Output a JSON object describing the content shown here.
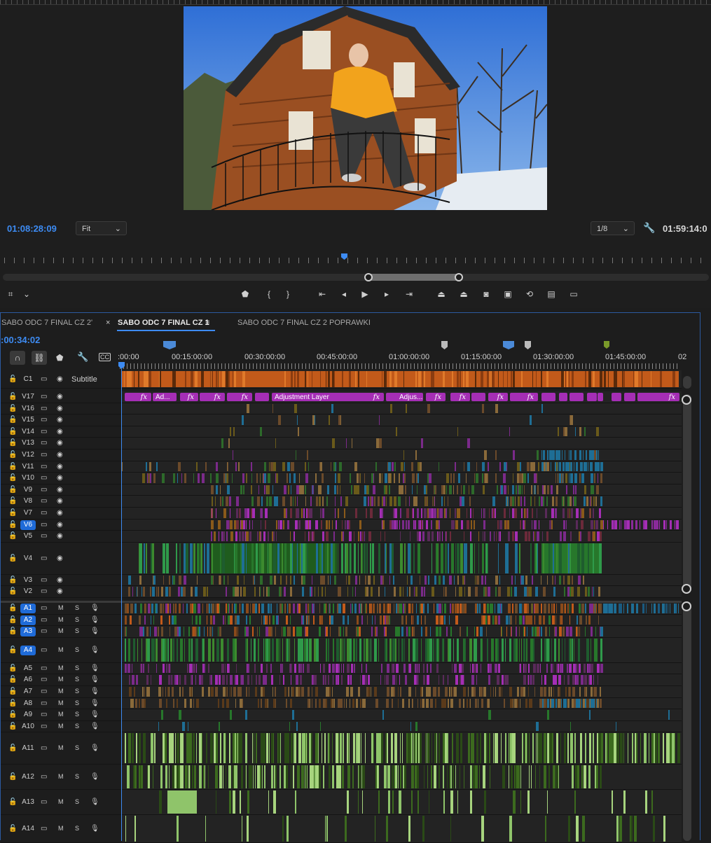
{
  "monitor": {
    "current_timecode": "01:08:28:09",
    "zoom_value": "Fit",
    "resolution_value": "1/8",
    "duration_timecode": "01:59:14:0",
    "playhead_fraction": 0.484
  },
  "timeline": {
    "tabs": [
      {
        "label": "SABO ODC 7 FINAL CZ 2'",
        "active": false
      },
      {
        "label": "SABO ODC 7 FINAL CZ 1",
        "active": true
      },
      {
        "label": "SABO ODC 7 FINAL CZ 2 POPRAWKI",
        "active": false
      }
    ],
    "close_glyph": "×",
    "menu_glyph": "≡",
    "current_timecode": ":00:34:02",
    "ruler_labels": [
      ":00:00",
      "00:15:00:00",
      "00:30:00:00",
      "00:45:00:00",
      "01:00:00:00",
      "01:15:00:00",
      "01:30:00:00",
      "01:45:00:00",
      "02"
    ],
    "subtitle_track": {
      "name": "C1",
      "label": "Subtitle"
    },
    "adjustment_layer_label": "Adjustment Layer",
    "adj_short_1": "Ad...",
    "adj_short_2": "Adjus...",
    "fx_label": "fx",
    "mute_label": "M",
    "solo_label": "S",
    "video_tracks": [
      "V17",
      "V16",
      "V15",
      "V14",
      "V13",
      "V12",
      "V11",
      "V10",
      "V9",
      "V8",
      "V7",
      "V6",
      "V5",
      "V4",
      "V3",
      "V2"
    ],
    "audio_tracks": [
      "A1",
      "A2",
      "A3",
      "A4",
      "A5",
      "A6",
      "A7",
      "A8",
      "A9",
      "A10",
      "A11",
      "A12",
      "A13",
      "A14"
    ],
    "targeted_tracks": [
      "V6",
      "A1",
      "A2",
      "A3",
      "A4"
    ],
    "colors": {
      "accent": "#3d8bf2",
      "orange_clip": "#c25a1a",
      "adjustment_clip": "#a52eb5",
      "green_clip": "#3c8a2e",
      "teal_clip": "#1e6e95",
      "audio_green": "#8fc46a"
    }
  }
}
